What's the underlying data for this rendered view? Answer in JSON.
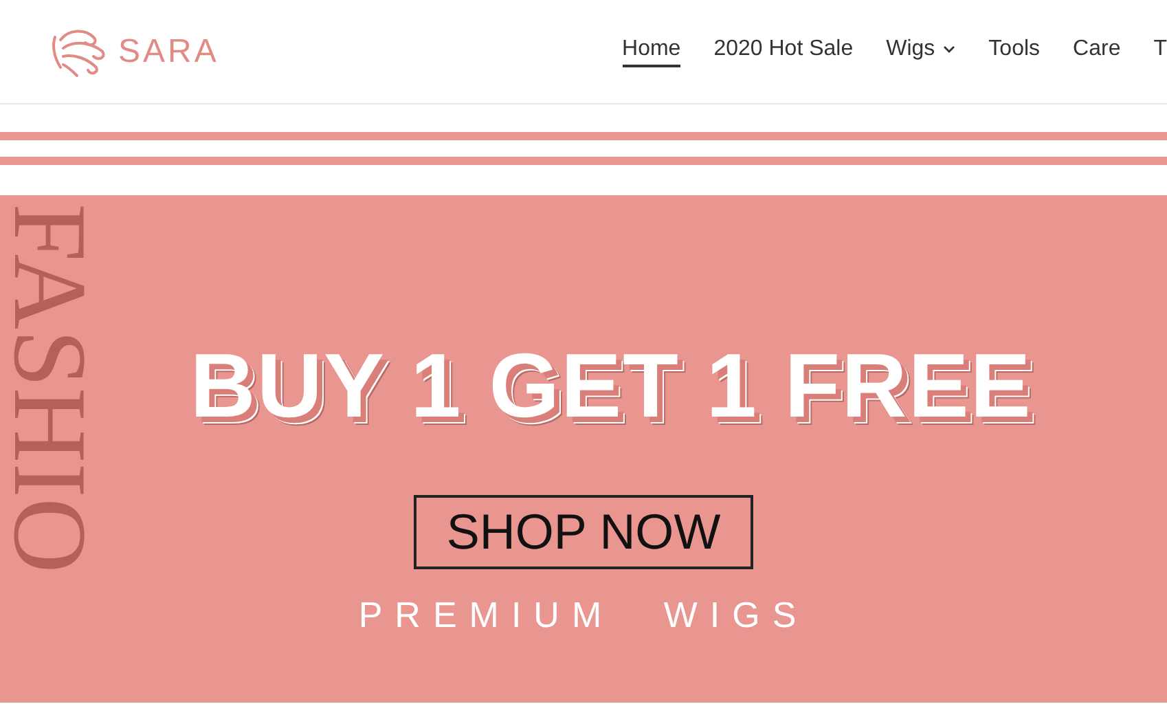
{
  "header": {
    "logo_text": "SARA",
    "nav": [
      {
        "label": "Home",
        "selected": true,
        "dropdown": false
      },
      {
        "label": "2020 Hot Sale",
        "selected": false,
        "dropdown": false
      },
      {
        "label": "Wigs",
        "selected": false,
        "dropdown": true
      },
      {
        "label": "Tools",
        "selected": false,
        "dropdown": false
      },
      {
        "label": "Care",
        "selected": false,
        "dropdown": false
      },
      {
        "label": "T",
        "selected": false,
        "dropdown": false
      }
    ]
  },
  "hero": {
    "side_text": "FASHIO",
    "headline": "BUY 1 GET 1 FREE",
    "button": "SHOP NOW",
    "tagline": "PREMIUM WIGS"
  }
}
